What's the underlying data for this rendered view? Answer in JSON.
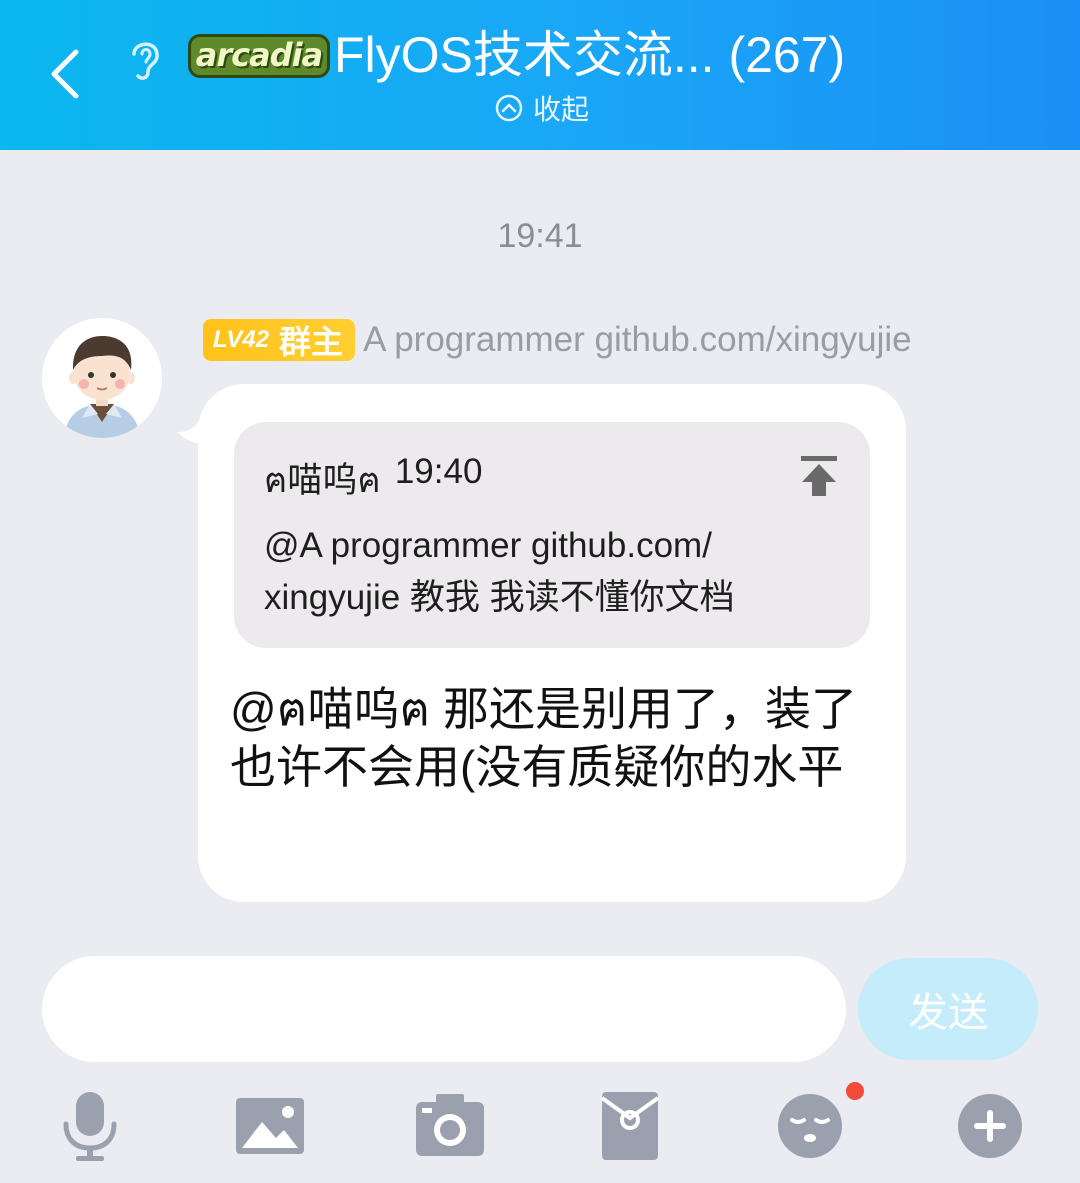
{
  "header": {
    "logo_text": "arcadia",
    "title": "FlyOS技术交流... (267)",
    "collapse_label": "收起"
  },
  "chat": {
    "timestamp": "19:41",
    "sender": {
      "level": "LV42",
      "role": "群主",
      "name": "A programmer github.com/xingyujie"
    },
    "quote": {
      "author": "ฅ喵呜ฅ",
      "time": "19:40",
      "text": "@A programmer github.com/ xingyujie 教我 我读不懂你文档"
    },
    "message": "@ฅ喵呜ฅ 那还是别用了，装了也许不会用(没有质疑你的水平"
  },
  "composer": {
    "input_value": "",
    "input_placeholder": "",
    "send_label": "发送"
  },
  "toolbar": {
    "icons": [
      "microphone-icon",
      "image-icon",
      "camera-icon",
      "red-packet-icon",
      "emoji-icon",
      "plus-icon"
    ],
    "emoji_has_badge": true
  },
  "colors": {
    "header_gradient_start": "#0ab7ee",
    "header_gradient_end": "#1a8ff5",
    "background": "#ebebf2",
    "badge_yellow": "#ffc21a",
    "send_button": "#c5ecfb",
    "icon_gray": "#9aa0ad",
    "notification_dot": "#f34b3b"
  }
}
